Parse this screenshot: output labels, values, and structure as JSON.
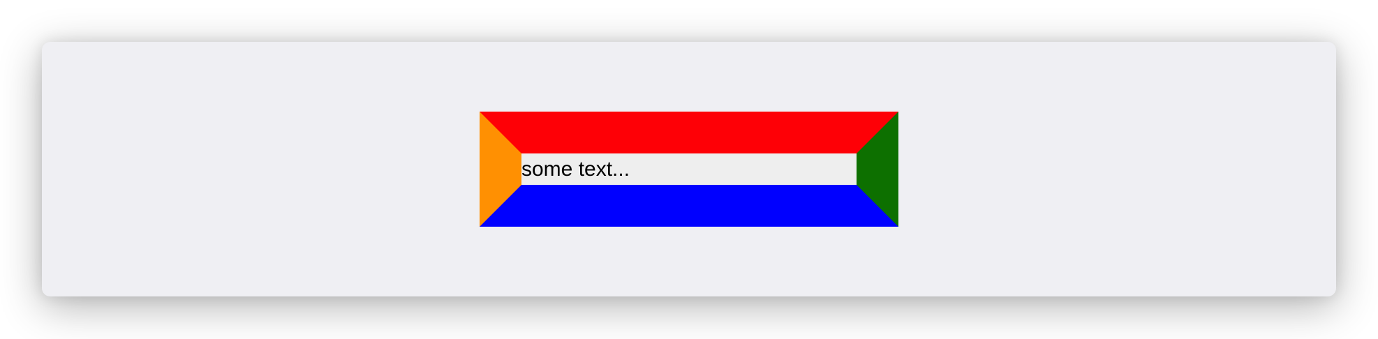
{
  "input": {
    "value": "some text..."
  },
  "colors": {
    "window_background": "#efeff3",
    "border_top": "#fe0006",
    "border_right": "#0d7000",
    "border_bottom": "#0000ff",
    "border_left": "#ff9002",
    "input_background": "#eeeeee"
  }
}
